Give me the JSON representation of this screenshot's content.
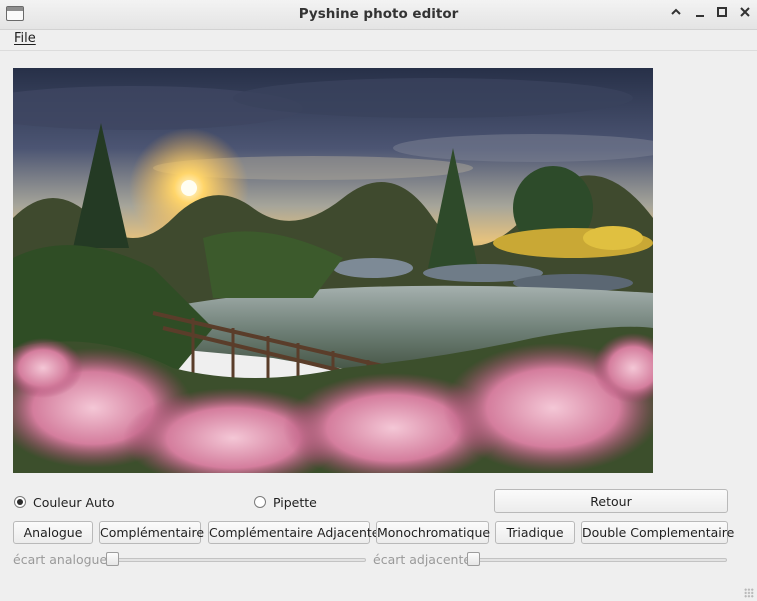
{
  "window": {
    "title": "Pyshine photo editor",
    "controls": [
      "chevron-up-icon",
      "minimize-icon",
      "maximize-icon",
      "close-icon"
    ]
  },
  "menu": {
    "file_label": "File"
  },
  "modes": {
    "auto_label": "Couleur Auto",
    "auto_selected": true,
    "pipette_label": "Pipette",
    "pipette_selected": false
  },
  "buttons": {
    "retour": "Retour",
    "analogue": "Analogue",
    "complementaire": "Complémentaire",
    "complementaire_adjacente": "Complémentaire Adjacente",
    "monochromatique": "Monochromatique",
    "triadique": "Triadique",
    "double_complementaire": "Double Complementaire"
  },
  "sliders": {
    "analogue_label": "écart analogue",
    "analogue_value": 0,
    "adjacente_label": "écart adjacente",
    "adjacente_value": 0
  },
  "colors": {
    "window_bg": "#efefef",
    "sky_top": "#2b3550",
    "sunset": "#f6b34a",
    "water": "#8f9ea3",
    "flowers": "#d98aa8"
  }
}
